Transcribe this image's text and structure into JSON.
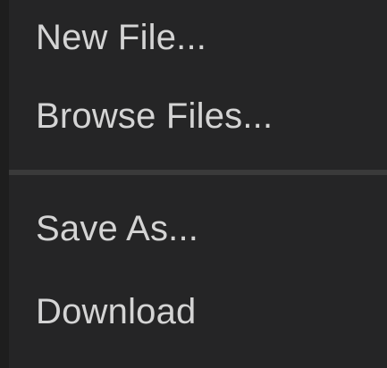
{
  "menu": {
    "groups": [
      {
        "items": [
          {
            "label": "New File..."
          },
          {
            "label": "Browse Files..."
          }
        ]
      },
      {
        "items": [
          {
            "label": "Save As..."
          },
          {
            "label": "Download"
          }
        ]
      }
    ]
  },
  "colors": {
    "menu_background": "#252526",
    "text": "#d4d4d4",
    "separator": "#3a3a3a"
  }
}
